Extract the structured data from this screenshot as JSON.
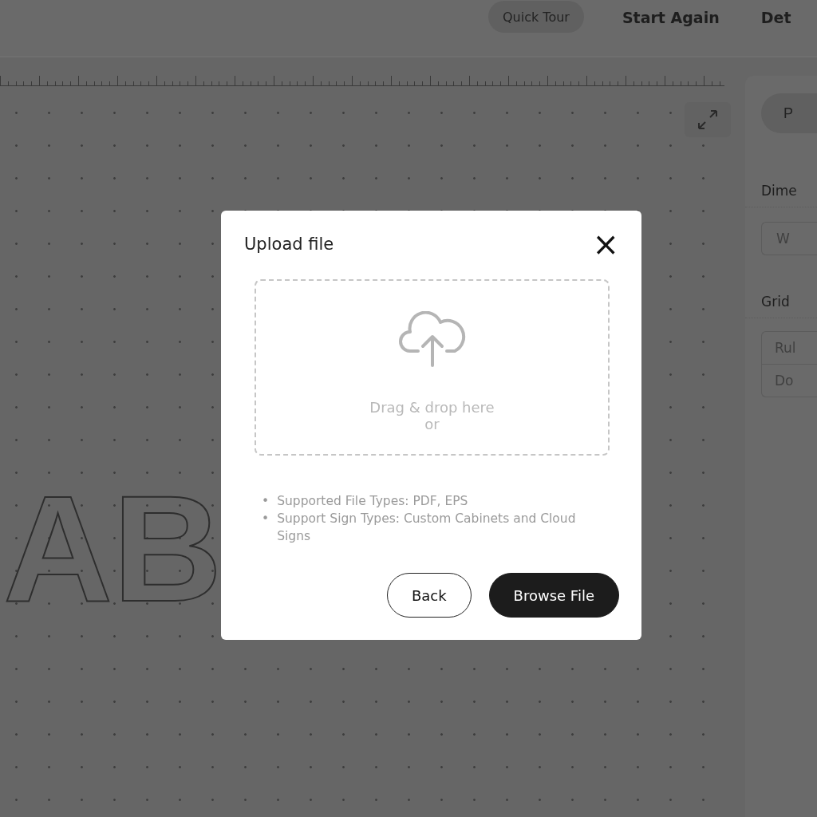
{
  "top_bar": {
    "quick_tour": "Quick Tour",
    "start_again": "Start Again",
    "next": "Det"
  },
  "canvas": {
    "text": "AB"
  },
  "side_panel": {
    "pill": "P",
    "dimensions_label": "Dime",
    "width_field": "W",
    "grid_label": "Grid",
    "grid_options": [
      {
        "label": "Rul"
      },
      {
        "label": "Do"
      }
    ]
  },
  "dialog": {
    "title": "Upload file",
    "close": "×",
    "dropzone": {
      "text": "Drag & drop here",
      "or": "or"
    },
    "notes": [
      {
        "bullet": "•",
        "text": "Supported File Types: PDF, EPS"
      },
      {
        "bullet": "•",
        "text": "Support Sign Types: Custom Cabinets and Cloud Signs"
      }
    ],
    "buttons": [
      {
        "label": "Back",
        "kind": "secondary"
      },
      {
        "label": "Browse File",
        "kind": "primary"
      }
    ]
  }
}
